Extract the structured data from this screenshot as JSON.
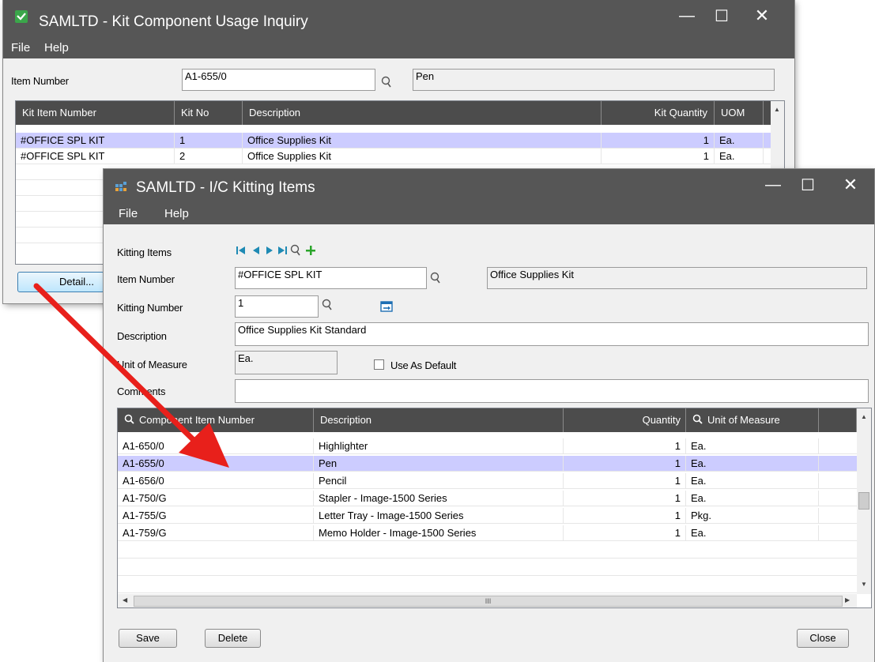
{
  "back_window": {
    "title": "SAMLTD - Kit Component Usage Inquiry",
    "menu": [
      "File",
      "Help"
    ],
    "item_number_label": "Item Number",
    "item_number_value": "A1-655/0",
    "item_description": "Pen",
    "columns": [
      "Kit Item Number",
      "Kit No",
      "Description",
      "Kit Quantity",
      "UOM"
    ],
    "rows": [
      [
        "#OFFICE SPL KIT",
        "1",
        "Office Supplies Kit",
        "1",
        "Ea."
      ],
      [
        "#OFFICE SPL KIT",
        "2",
        "Office Supplies Kit",
        "1",
        "Ea."
      ]
    ],
    "detail_button": "Detail..."
  },
  "front_window": {
    "title": "SAMLTD - I/C Kitting Items",
    "menu": [
      "File",
      "Help"
    ],
    "kitting_items_label": "Kitting Items",
    "item_number_label": "Item Number",
    "item_number_value": "#OFFICE SPL KIT",
    "item_description": "Office Supplies Kit",
    "kitting_number_label": "Kitting Number",
    "kitting_number_value": "1",
    "description_label": "Description",
    "description_value": "Office Supplies Kit Standard",
    "uom_label": "Unit of Measure",
    "uom_value": "Ea.",
    "use_as_default_label": "Use As Default",
    "comments_label": "Comments",
    "comments_value": "",
    "columns": [
      "Component Item Number",
      "Description",
      "Quantity",
      "Unit of Measure"
    ],
    "rows": [
      [
        "A1-650/0",
        "Highlighter",
        "1",
        "Ea."
      ],
      [
        "A1-655/0",
        "Pen",
        "1",
        "Ea."
      ],
      [
        "A1-656/0",
        "Pencil",
        "1",
        "Ea."
      ],
      [
        "A1-750/G",
        "Stapler - Image-1500 Series",
        "1",
        "Ea."
      ],
      [
        "A1-755/G",
        "Letter Tray - Image-1500 Series",
        "1",
        "Pkg."
      ],
      [
        "A1-759/G",
        "Memo Holder - Image-1500 Series",
        "1",
        "Ea."
      ]
    ],
    "hscroll_glyph": "III",
    "save_button": "Save",
    "delete_button": "Delete",
    "close_button": "Close"
  },
  "colors": {
    "titlebar": "#565656",
    "grid_header": "#4c4c4c",
    "selected_row": "#ccccff",
    "nav_arrows": "#1e8ab4",
    "add_icon": "#2aa52a",
    "arrow_annotation": "#e8201b"
  },
  "icons": {
    "back_app_icon": "shield-check-icon",
    "front_app_icon": "kitting-grid-icon",
    "finder": "magnifier-icon",
    "drilldown": "drilldown-icon"
  }
}
